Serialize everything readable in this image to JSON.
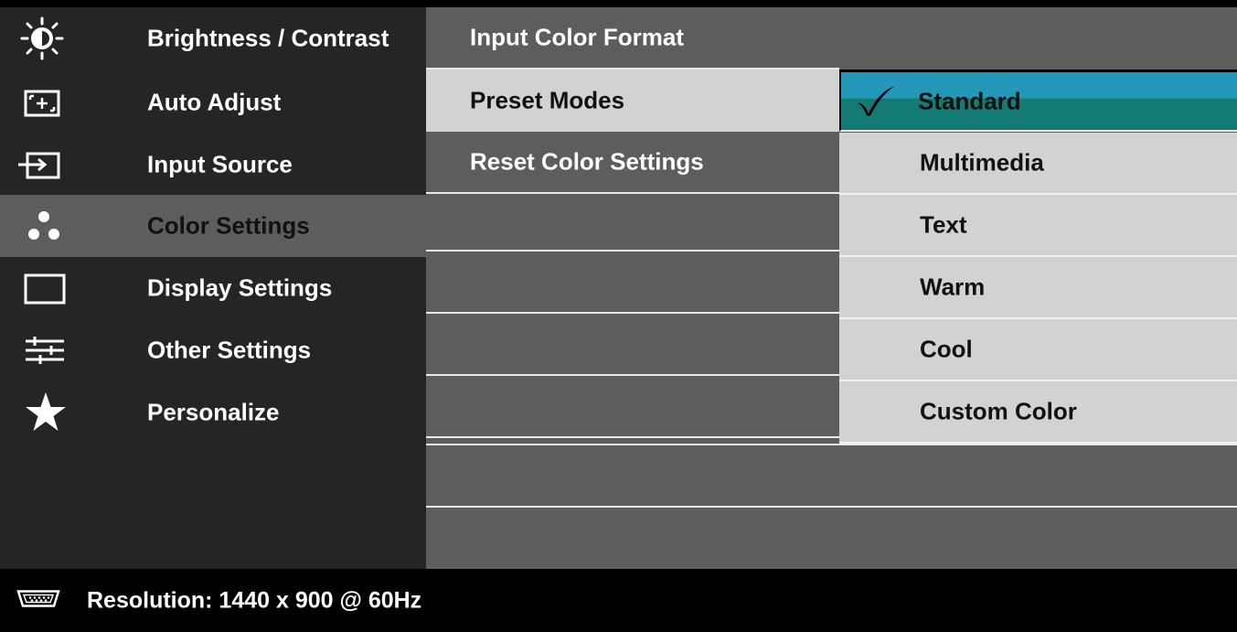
{
  "main_menu": [
    {
      "label": "Brightness / Contrast",
      "icon": "brightness-icon"
    },
    {
      "label": "Auto Adjust",
      "icon": "auto-adjust-icon"
    },
    {
      "label": "Input Source",
      "icon": "input-source-icon"
    },
    {
      "label": "Color Settings",
      "icon": "color-settings-icon",
      "active": true
    },
    {
      "label": "Display Settings",
      "icon": "display-settings-icon"
    },
    {
      "label": "Other Settings",
      "icon": "other-settings-icon"
    },
    {
      "label": "Personalize",
      "icon": "star-icon"
    }
  ],
  "submenu": [
    {
      "label": "Input Color Format"
    },
    {
      "label": "Preset Modes",
      "selected": true
    },
    {
      "label": "Reset Color Settings"
    }
  ],
  "preset_options": [
    {
      "label": "Standard",
      "current": true
    },
    {
      "label": "Multimedia"
    },
    {
      "label": "Text"
    },
    {
      "label": "Warm"
    },
    {
      "label": "Cool"
    },
    {
      "label": "Custom Color"
    }
  ],
  "status": {
    "icon": "vga-connector-icon",
    "resolution_text": "Resolution: 1440 x 900 @ 60Hz"
  },
  "colors": {
    "accent_top": "#2497b8",
    "accent_bottom": "#147a74",
    "panel_dark": "#252525",
    "panel_mid": "#5c5d5c",
    "option_bg": "#d2d2d2"
  }
}
